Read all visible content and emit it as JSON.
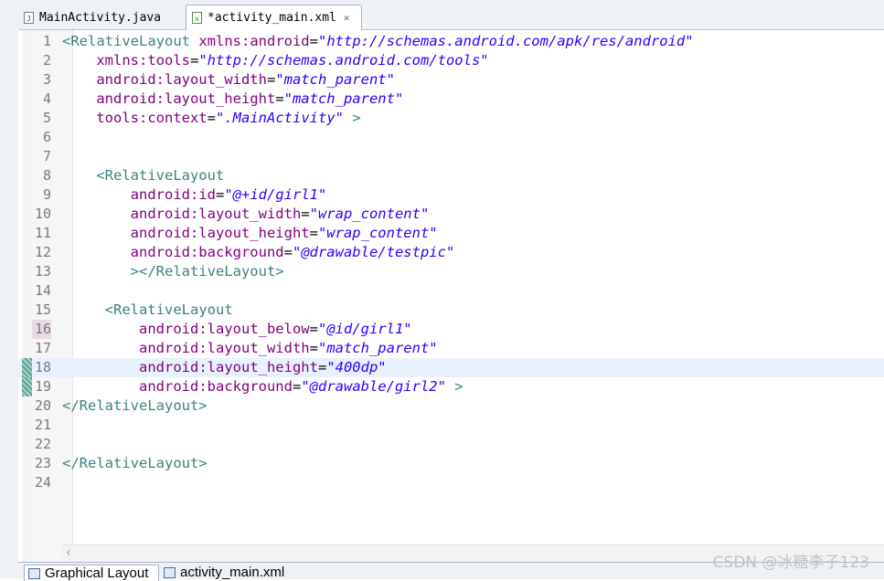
{
  "tabs": [
    {
      "label": "MainActivity.java",
      "icon": "java-file-icon",
      "active": false
    },
    {
      "label": "*activity_main.xml",
      "icon": "xml-file-icon",
      "active": true,
      "close": "✕"
    }
  ],
  "editor": {
    "current_line": 18,
    "lines": [
      {
        "n": "1"
      },
      {
        "n": "2"
      },
      {
        "n": "3"
      },
      {
        "n": "4"
      },
      {
        "n": "5"
      },
      {
        "n": "6"
      },
      {
        "n": "7"
      },
      {
        "n": "8"
      },
      {
        "n": "9"
      },
      {
        "n": "10"
      },
      {
        "n": "11"
      },
      {
        "n": "12"
      },
      {
        "n": "13"
      },
      {
        "n": "14"
      },
      {
        "n": "15"
      },
      {
        "n": "16"
      },
      {
        "n": "17"
      },
      {
        "n": "18"
      },
      {
        "n": "19"
      },
      {
        "n": "20"
      },
      {
        "n": "21"
      },
      {
        "n": "22"
      },
      {
        "n": "23"
      },
      {
        "n": "24"
      }
    ],
    "code": {
      "l1_tag": "<RelativeLayout",
      "l1_attr": "xmlns:android",
      "l1_val": "\"http://schemas.android.com/apk/res/android\"",
      "l2_attr": "xmlns:tools",
      "l2_val": "\"http://schemas.android.com/tools\"",
      "l3_attr": "android:layout_width",
      "l3_val": "\"match_parent\"",
      "l4_attr": "android:layout_height",
      "l4_val": "\"match_parent\"",
      "l5_attr": "tools:context",
      "l5_val": "\".MainActivity\"",
      "l5_end": ">",
      "l8_tag": "<RelativeLayout",
      "l9_attr": "android:id",
      "l9_val": "\"@+id/girl1\"",
      "l10_attr": "android:layout_width",
      "l10_val": "\"wrap_content\"",
      "l11_attr": "android:layout_height",
      "l11_val": "\"wrap_content\"",
      "l12_attr": "android:background",
      "l12_val": "\"@drawable/testpic\"",
      "l13_tag": "></RelativeLayout>",
      "l15_tag": "<RelativeLayout",
      "l16_attr": "android:layout_below",
      "l16_val": "\"@id/girl1\"",
      "l17_attr": "android:layout_width",
      "l17_val": "\"match_parent\"",
      "l18_attr": "android:layout_height",
      "l18_val": "\"400dp\"",
      "l19_attr": "android:background",
      "l19_val": "\"@drawable/girl2\"",
      "l19_end": ">",
      "l20_tag": "</RelativeLayout>",
      "l23_tag": "</RelativeLayout>"
    }
  },
  "bottom_tabs": [
    {
      "label": "Graphical Layout"
    },
    {
      "label": "activity_main.xml"
    }
  ],
  "watermark": "CSDN @冰糖李子123"
}
